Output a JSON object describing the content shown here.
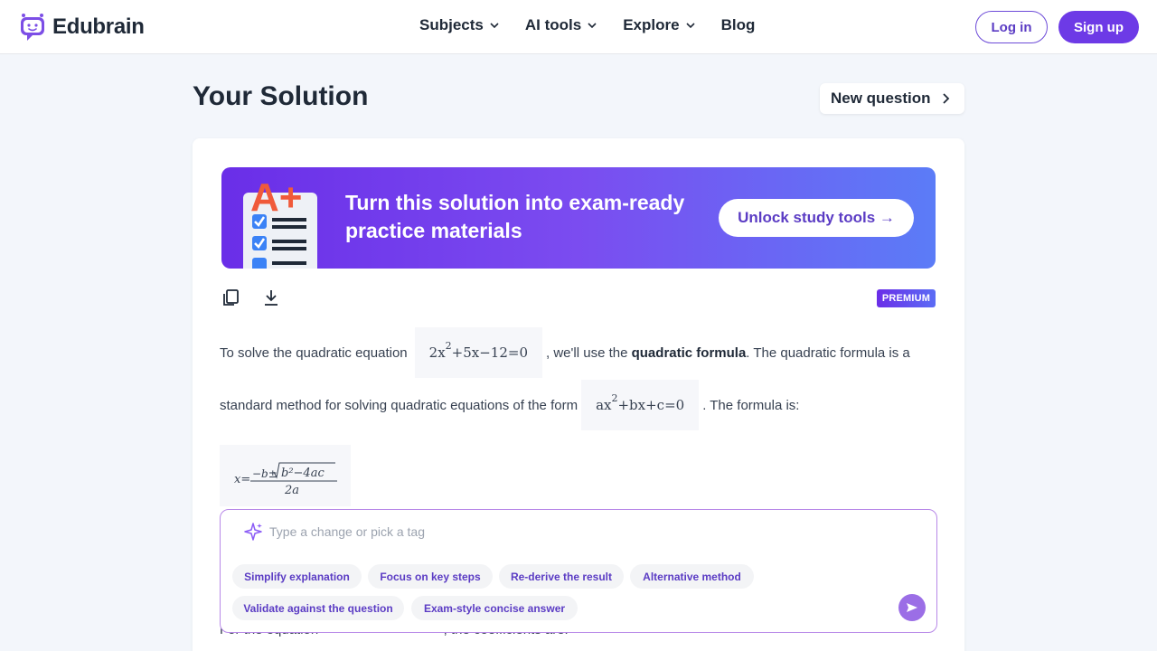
{
  "brand": {
    "name": "Edubrain"
  },
  "nav": {
    "items": [
      {
        "label": "Subjects",
        "has_dropdown": true
      },
      {
        "label": "AI tools",
        "has_dropdown": true
      },
      {
        "label": "Explore",
        "has_dropdown": true
      },
      {
        "label": "Blog",
        "has_dropdown": false
      }
    ],
    "login": "Log in",
    "signup": "Sign up"
  },
  "page": {
    "title": "Your Solution",
    "new_question": "New question"
  },
  "banner": {
    "text": "Turn this solution into exam-ready practice materials",
    "cta": "Unlock study tools →",
    "art_label": "A+"
  },
  "toolbar": {
    "copy_icon": "copy-icon",
    "download_icon": "download-icon",
    "premium_badge": "PREMIUM"
  },
  "solution": {
    "p1_before": "To solve the quadratic equation",
    "p1_eq_main": "2x",
    "p1_eq_sup": "2",
    "p1_eq_rest": "+5x−12=0",
    "p1_after": ", we'll use the",
    "p1_bold": "quadratic formula",
    "p1_end": ". The quadratic formula is a",
    "p2_before": "standard method for solving quadratic equations of the form",
    "p2_eq_main": "ax",
    "p2_eq_sup": "2",
    "p2_eq_rest": "+bx+c=0",
    "p2_after": ". The formula is:",
    "formula_lhs": "x=",
    "formula_num": "−b±",
    "formula_rad": "b²−4ac",
    "formula_den": "2a",
    "p3_partial": "For the equation",
    "p3_partial_end": ", the coefficients are:"
  },
  "prompt": {
    "placeholder": "Type a change or pick a tag",
    "tags_row1": [
      "Simplify explanation",
      "Focus on key steps",
      "Re-derive the result",
      "Alternative method"
    ],
    "tags_row2": [
      "Validate against the question",
      "Exam-style concise answer"
    ]
  },
  "colors": {
    "accent": "#6d3ae6",
    "banner_start": "#6a2ee8",
    "banner_end": "#5b7cf7",
    "tag_text": "#5b3cc4"
  }
}
